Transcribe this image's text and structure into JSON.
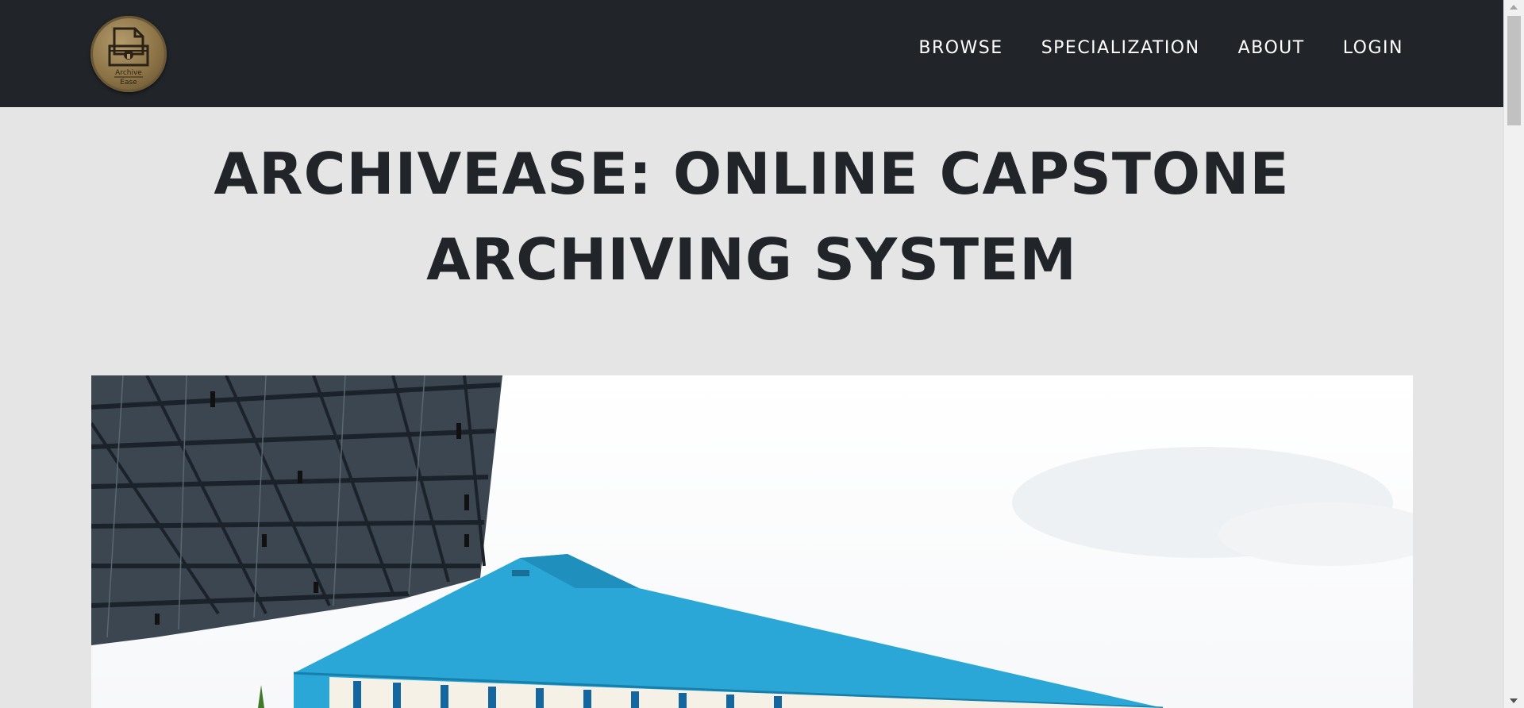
{
  "brand": {
    "logo_text_line1": "Archive",
    "logo_text_line2": "Ease",
    "logo_icon": "archive-box-lock-icon"
  },
  "nav": {
    "items": [
      {
        "label": "BROWSE"
      },
      {
        "label": "SPECIALIZATION"
      },
      {
        "label": "ABOUT"
      },
      {
        "label": "LOGIN"
      }
    ]
  },
  "hero": {
    "title_line1": "ARCHIVEASE: ONLINE CAPSTONE",
    "title_line2": "ARCHIVING SYSTEM",
    "image_subject": "campus building with blue roof under a steel-truss canopy"
  },
  "colors": {
    "navbar": "#212529",
    "page_bg": "#e5e5e5",
    "title_text": "#212529",
    "roof_blue": "#2aa7d6",
    "nav_text": "#ffffff"
  }
}
